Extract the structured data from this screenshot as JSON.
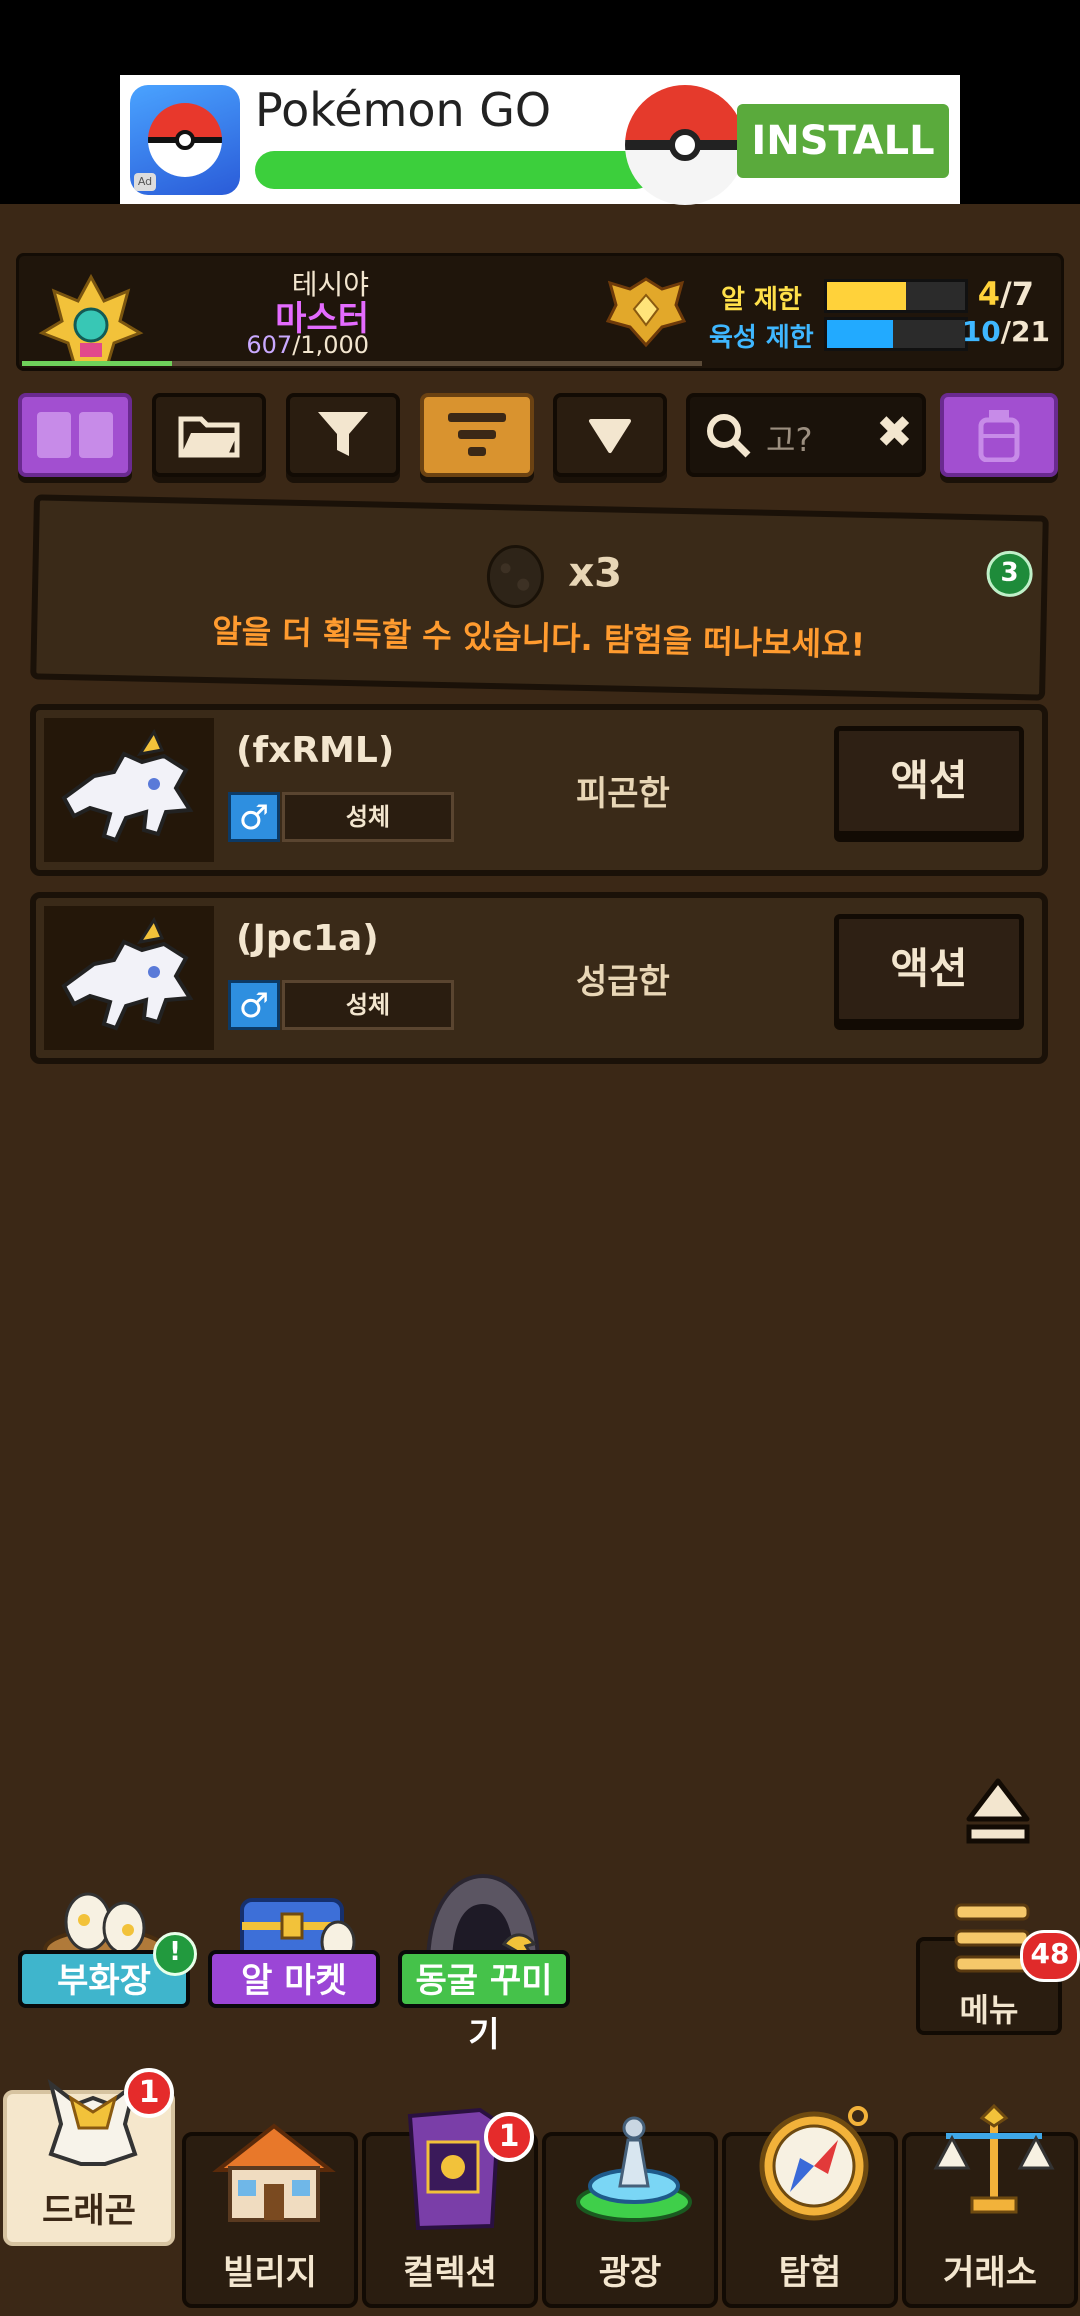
{
  "ad": {
    "title": "Pokémon GO",
    "install_label": "INSTALL",
    "ad_tag": "Ad"
  },
  "player": {
    "name": "테시야",
    "rank": "마스터",
    "xp_current": "607",
    "xp_max": "/1,000",
    "egg_limit_label": "알 제한",
    "raise_limit_label": "육성 제한",
    "egg_count": "4",
    "egg_max": "/7",
    "egg_fill": 0.57,
    "raise_count": "10",
    "raise_max": "/21",
    "raise_fill": 0.48
  },
  "toolbar": {
    "search_placeholder": "고?",
    "clear_symbol": "✖"
  },
  "egg_banner": {
    "count": "x3",
    "message": "알을 더 획득할 수 있습니다. 탐험을 떠나보세요!",
    "badge": "3"
  },
  "dragons": [
    {
      "name": "(fxRML)",
      "gender": "♂",
      "stage": "성체",
      "trait": "피곤한",
      "action": "액션"
    },
    {
      "name": "(Jpc1a)",
      "gender": "♂",
      "stage": "성체",
      "trait": "성급한",
      "action": "액션"
    }
  ],
  "quick": {
    "hatchery": "부화장",
    "hatchery_badge": "!",
    "egg_market": "알 마켓",
    "cave_decor": "동굴 꾸미기"
  },
  "menu": {
    "label": "메뉴",
    "badge": "48"
  },
  "tabs": [
    {
      "label": "드래곤",
      "badge": "1"
    },
    {
      "label": "빌리지"
    },
    {
      "label": "컬렉션",
      "badge": "1"
    },
    {
      "label": "광장"
    },
    {
      "label": "탐험"
    },
    {
      "label": "거래소"
    }
  ],
  "colors": {
    "background": "#3b2816",
    "rank": "#e46bff",
    "egg_bar": "#ffd23a",
    "raise_bar": "#22aaff",
    "banner_text": "#ff9b2f"
  }
}
